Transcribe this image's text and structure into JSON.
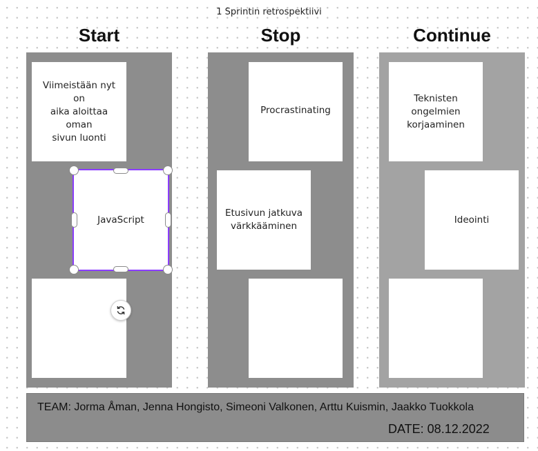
{
  "board": {
    "title": "1 Sprintin retrospektiivi"
  },
  "columns": [
    {
      "heading": "Start",
      "color": "#8d8d8d",
      "notes": [
        {
          "text_lines": [
            "Viimeistään nyt on",
            "aika aloittaa oman",
            "sivun luonti"
          ]
        },
        {
          "text_lines": [
            "JavaScript"
          ],
          "selected": true
        },
        {
          "text_lines": []
        }
      ]
    },
    {
      "heading": "Stop",
      "color": "#8d8d8d",
      "notes": [
        {
          "text_lines": [
            "Procrastinating"
          ]
        },
        {
          "text_lines": [
            "Etusivun jatkuva",
            "värkkääminen"
          ]
        },
        {
          "text_lines": []
        }
      ]
    },
    {
      "heading": "Continue",
      "color": "#a3a3a3",
      "notes": [
        {
          "text_lines": [
            "Teknisten",
            "ongelmien",
            "korjaaminen"
          ]
        },
        {
          "text_lines": [
            "Ideointi"
          ]
        },
        {
          "text_lines": []
        }
      ]
    }
  ],
  "footer": {
    "team": "TEAM: Jorma Åman, Jenna Hongisto, Simeoni Valkonen, Arttu Kuismin, Jaakko Tuokkola",
    "date": "DATE: 08.12.2022",
    "color": "#8c8c8c"
  },
  "selection": {
    "accent_color": "#8b3dff",
    "rotate_icon": "rotate-icon"
  }
}
